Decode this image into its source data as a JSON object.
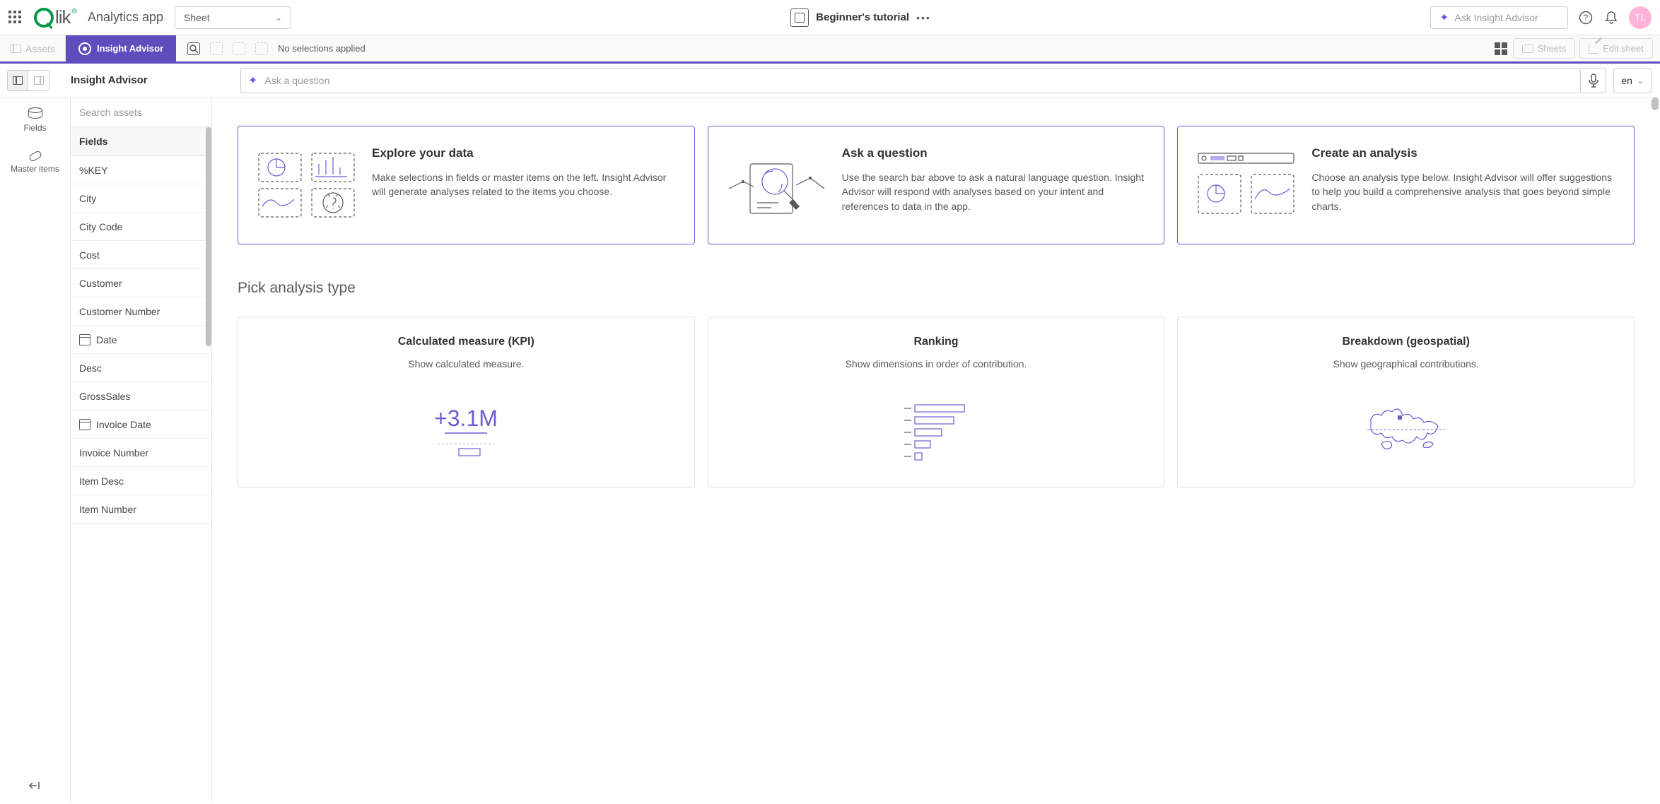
{
  "topbar": {
    "app_name": "Analytics app",
    "sheet_dropdown": "Sheet",
    "tutorial": "Beginner's tutorial",
    "ask_insight_placeholder": "Ask Insight Advisor",
    "avatar_initials": "TL"
  },
  "toolbar": {
    "assets_label": "Assets",
    "insight_advisor_label": "Insight Advisor",
    "no_selections": "No selections applied",
    "sheets_label": "Sheets",
    "edit_sheet_label": "Edit sheet"
  },
  "subheader": {
    "title": "Insight Advisor",
    "search_placeholder": "Ask a question",
    "lang": "en"
  },
  "rail": {
    "fields": "Fields",
    "master_items": "Master items"
  },
  "fields_panel": {
    "search_placeholder": "Search assets",
    "header": "Fields",
    "items": [
      {
        "label": "%KEY",
        "has_icon": false
      },
      {
        "label": "City",
        "has_icon": false
      },
      {
        "label": "City Code",
        "has_icon": false
      },
      {
        "label": "Cost",
        "has_icon": false
      },
      {
        "label": "Customer",
        "has_icon": false
      },
      {
        "label": "Customer Number",
        "has_icon": false
      },
      {
        "label": "Date",
        "has_icon": true
      },
      {
        "label": "Desc",
        "has_icon": false
      },
      {
        "label": "GrossSales",
        "has_icon": false
      },
      {
        "label": "Invoice Date",
        "has_icon": true
      },
      {
        "label": "Invoice Number",
        "has_icon": false
      },
      {
        "label": "Item Desc",
        "has_icon": false
      },
      {
        "label": "Item Number",
        "has_icon": false
      }
    ]
  },
  "intro_cards": [
    {
      "title": "Explore your data",
      "body": "Make selections in fields or master items on the left. Insight Advisor will generate analyses related to the items you choose."
    },
    {
      "title": "Ask a question",
      "body": "Use the search bar above to ask a natural language question. Insight Advisor will respond with analyses based on your intent and references to data in the app."
    },
    {
      "title": "Create an analysis",
      "body": "Choose an analysis type below. Insight Advisor will offer suggestions to help you build a comprehensive analysis that goes beyond simple charts."
    }
  ],
  "pick_title": "Pick analysis type",
  "analysis_cards": [
    {
      "title": "Calculated measure (KPI)",
      "subtitle": "Show calculated measure."
    },
    {
      "title": "Ranking",
      "subtitle": "Show dimensions in order of contribution."
    },
    {
      "title": "Breakdown (geospatial)",
      "subtitle": "Show geographical contributions."
    }
  ]
}
